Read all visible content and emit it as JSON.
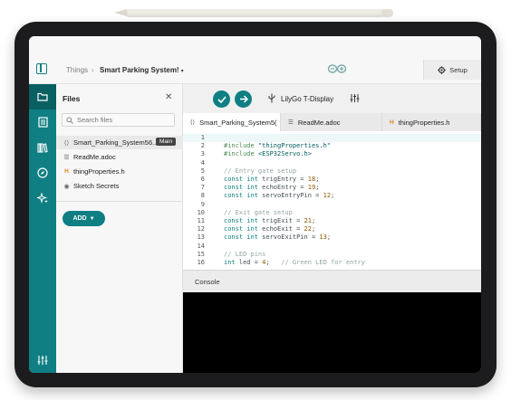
{
  "header": {
    "breadcrumb_root": "Things",
    "separator": "›",
    "sketch_title": "Smart Parking System!",
    "setup_label": "Setup"
  },
  "files_panel": {
    "title": "Files",
    "search_placeholder": "Search files",
    "files": [
      {
        "name": "Smart_Parking_System56...",
        "icon": "code-icon",
        "badge": "Main"
      },
      {
        "name": "ReadMe.adoc",
        "icon": "doc-icon"
      },
      {
        "name": "thingProperties.h",
        "icon": "header-icon"
      },
      {
        "name": "Sketch Secrets",
        "icon": "eye-icon"
      }
    ],
    "add_label": "ADD"
  },
  "toolbar": {
    "board_name": "LilyGo T-Display"
  },
  "tabs": [
    {
      "label": "Smart_Parking_System5(",
      "icon": "code-icon"
    },
    {
      "label": "ReadMe.adoc",
      "icon": "doc-icon"
    },
    {
      "label": "thingProperties.h",
      "icon": "header-icon"
    }
  ],
  "code_lines": [
    {
      "n": "1",
      "text": ""
    },
    {
      "n": "2",
      "text": "#include \"thingProperties.h\""
    },
    {
      "n": "3",
      "text": "#include <ESP32Servo.h>"
    },
    {
      "n": "4",
      "text": ""
    },
    {
      "n": "5",
      "text": "// Entry gate setup"
    },
    {
      "n": "6",
      "text": "const int trigEntry = 18;"
    },
    {
      "n": "7",
      "text": "const int echoEntry = 19;"
    },
    {
      "n": "8",
      "text": "const int servoEntryPin = 12;"
    },
    {
      "n": "9",
      "text": ""
    },
    {
      "n": "10",
      "text": "// Exit gate setup"
    },
    {
      "n": "11",
      "text": "const int trigExit = 21;"
    },
    {
      "n": "12",
      "text": "const int echoExit = 22;"
    },
    {
      "n": "13",
      "text": "const int servoExitPin = 13;"
    },
    {
      "n": "14",
      "text": ""
    },
    {
      "n": "15",
      "text": "// LED pins"
    },
    {
      "n": "16",
      "text": "int led = 4;   // Green LED for entry"
    }
  ],
  "console": {
    "label": "Console"
  },
  "colors": {
    "accent": "#0f7f83",
    "rail_active": "#0a5f63",
    "console_bg": "#000000"
  }
}
